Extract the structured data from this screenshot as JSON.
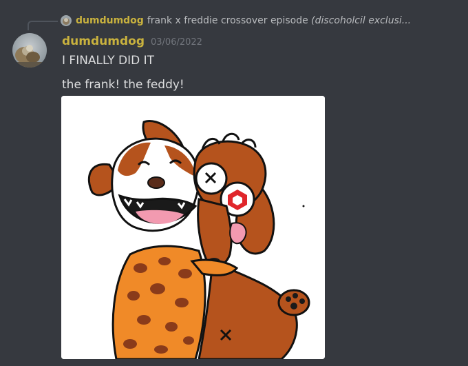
{
  "reply": {
    "author": "dumdumdog",
    "text": "frank x freddie crossover episode",
    "text_italic": "(discoholcil exclusi..."
  },
  "message": {
    "author": "dumdumdog",
    "timestamp": "03/06/2022",
    "lines": [
      "I FINALLY DID IT",
      "the frank! the feddy!"
    ]
  },
  "attachment": {
    "type": "image",
    "subject": "two cartoon dogs hugging"
  },
  "colors": {
    "background": "#36393f",
    "username": "#c9b23e",
    "text": "#dcddde",
    "timestamp": "#72767d",
    "reply_text": "#b9bbbe"
  },
  "icons": {
    "avatar": "dog-photo-avatar",
    "reply_avatar": "dog-photo-avatar-small"
  }
}
